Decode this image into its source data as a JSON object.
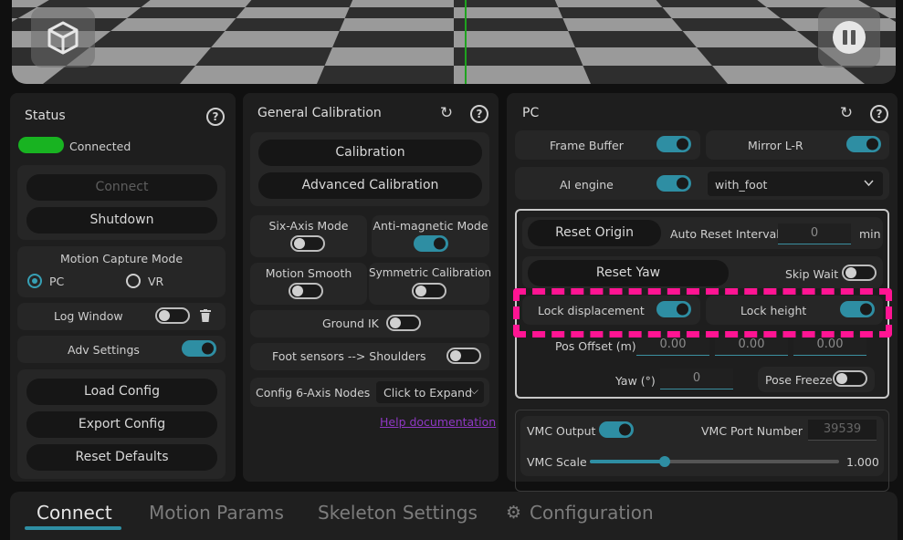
{
  "status_panel": {
    "title": "Status",
    "connection_status": "Connected",
    "status_color": "#18b321",
    "connect_label": "Connect",
    "shutdown_label": "Shutdown",
    "mocap_mode_title": "Motion Capture Mode",
    "mode_pc": "PC",
    "mode_vr": "VR",
    "log_window_label": "Log Window",
    "adv_settings_label": "Adv Settings",
    "load_config_label": "Load Config",
    "export_config_label": "Export Config",
    "reset_defaults_label": "Reset Defaults"
  },
  "calibration_panel": {
    "title": "General Calibration",
    "calibration_label": "Calibration",
    "advanced_calibration_label": "Advanced Calibration",
    "six_axis_label": "Six-Axis Mode",
    "anti_magnetic_label": "Anti-magnetic Mode",
    "motion_smooth_label": "Motion Smooth",
    "symmetric_calibration_label": "Symmetric Calibration",
    "ground_ik_label": "Ground IK",
    "foot_sensors_label": "Foot sensors  -->  Shoulders",
    "config_nodes_label": "Config 6-Axis Nodes",
    "config_nodes_value": "Click to Expand",
    "help_link": "Help documentation"
  },
  "pc_panel": {
    "title": "PC",
    "frame_buffer_label": "Frame Buffer",
    "mirror_label": "Mirror L-R",
    "ai_engine_label": "AI engine",
    "ai_engine_value": "with_foot",
    "reset_origin_label": "Reset Origin",
    "auto_reset_label": "Auto Reset Interval",
    "auto_reset_value": "0",
    "auto_reset_unit": "min",
    "reset_yaw_label": "Reset Yaw",
    "skip_wait_label": "Skip Wait",
    "lock_displacement_label": "Lock displacement",
    "lock_height_label": "Lock height",
    "pos_offset_label": "Pos Offset (m)",
    "pos_offset_x": "0.00",
    "pos_offset_y": "0.00",
    "pos_offset_z": "0.00",
    "yaw_label": "Yaw (°)",
    "yaw_value": "0",
    "pose_freeze_label": "Pose Freeze",
    "vmc_output_label": "VMC Output",
    "vmc_port_label": "VMC Port Number",
    "vmc_port_value": "39539",
    "vmc_scale_label": "VMC Scale",
    "vmc_scale_value": "1.000",
    "vmc_scale_fraction": 0.3
  },
  "tabs": [
    {
      "label": "Connect"
    },
    {
      "label": "Motion Params"
    },
    {
      "label": "Skeleton Settings"
    },
    {
      "label": "Configuration"
    }
  ],
  "colors": {
    "accent": "#2e8ea3",
    "highlight": "#ff1493"
  }
}
